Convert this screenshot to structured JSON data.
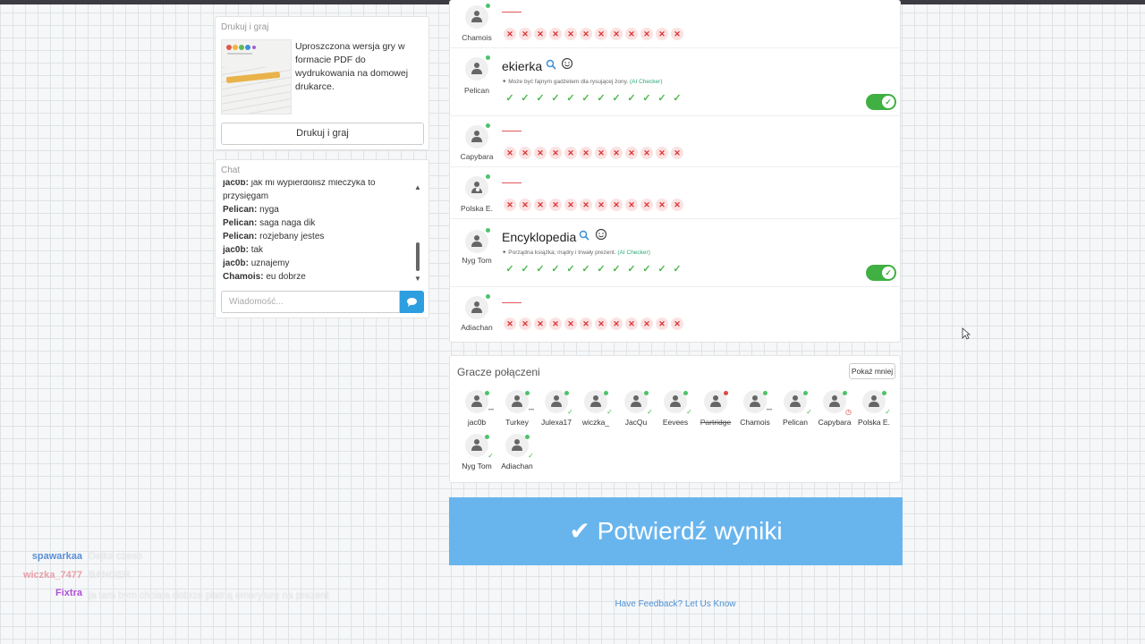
{
  "print_panel": {
    "title": "Drukuj i graj",
    "description": "Uproszczona wersja gry w formacie PDF do wydrukowania na domowej drukarce.",
    "button_label": "Drukuj i graj"
  },
  "chat": {
    "title": "Chat",
    "messages": [
      {
        "user": "jac0b:",
        "text": "jak mi wypierdolisz mleczyka to przysięgam"
      },
      {
        "user": "Pelican:",
        "text": "nyga"
      },
      {
        "user": "Pelican:",
        "text": "saga naga dik"
      },
      {
        "user": "Pelican:",
        "text": "rozjebany jestes"
      },
      {
        "user": "jac0b:",
        "text": "tak"
      },
      {
        "user": "jac0b:",
        "text": "uznajemy"
      },
      {
        "user": "Chamois:",
        "text": "eu dobrze"
      }
    ],
    "input_placeholder": "Wiadomość..."
  },
  "answers": [
    {
      "player": "Chamois",
      "word": "",
      "note": "",
      "ai": "",
      "result": "x"
    },
    {
      "player": "Pelican",
      "word": "ekierka",
      "note": "Może być fajnym gadżetem dla rysującej żony.",
      "ai": "(AI Checker)",
      "result": "check"
    },
    {
      "player": "Capybara",
      "word": "",
      "note": "",
      "ai": "",
      "result": "x"
    },
    {
      "player": "Polska E.",
      "word": "",
      "note": "",
      "ai": "",
      "result": "x"
    },
    {
      "player": "Nyg Tom",
      "word": "Encyklopedia",
      "note": "Porządna książka; mądry i trwały prezent.",
      "ai": "(AI Checker)",
      "result": "check"
    },
    {
      "player": "Adiachan",
      "word": "",
      "note": "",
      "ai": "",
      "result": "x"
    }
  ],
  "players_connected": {
    "title": "Gracze połączeni",
    "toggle_label": "Pokaż mniej",
    "players": [
      {
        "name": "jac0b",
        "status": "typing"
      },
      {
        "name": "Turkey",
        "status": "typing"
      },
      {
        "name": "Julexa17",
        "status": "done"
      },
      {
        "name": "wiczka_",
        "status": "done"
      },
      {
        "name": "JacQu",
        "status": "done"
      },
      {
        "name": "Eevees",
        "status": "done"
      },
      {
        "name": "Partridge",
        "status": "offline"
      },
      {
        "name": "Chamois",
        "status": "typing"
      },
      {
        "name": "Pelican",
        "status": "done"
      },
      {
        "name": "Capybara",
        "status": "timer"
      },
      {
        "name": "Polska E.",
        "status": "done"
      },
      {
        "name": "Nyg Tom",
        "status": "done"
      },
      {
        "name": "Adiachan",
        "status": "done"
      }
    ]
  },
  "confirm_button": "Potwierdź wyniki",
  "feedback_link": "Have Feedback? Let Us Know",
  "twitch_chat": [
    {
      "user": "spawarkaa",
      "text": "Dejka czeso",
      "color": "#5b8fd6"
    },
    {
      "user": "wiczka_7477",
      "text": "BANGER",
      "color": "#e8a0a8"
    },
    {
      "user": "Fixtra",
      "text": "ja tam bym chciała dobrze płatną emeryturę na prezent",
      "color": "#b24fd8"
    }
  ],
  "colors": {
    "accent": "#68b5ee",
    "toggle_green": "#3fb041",
    "link": "#4d91d6"
  }
}
